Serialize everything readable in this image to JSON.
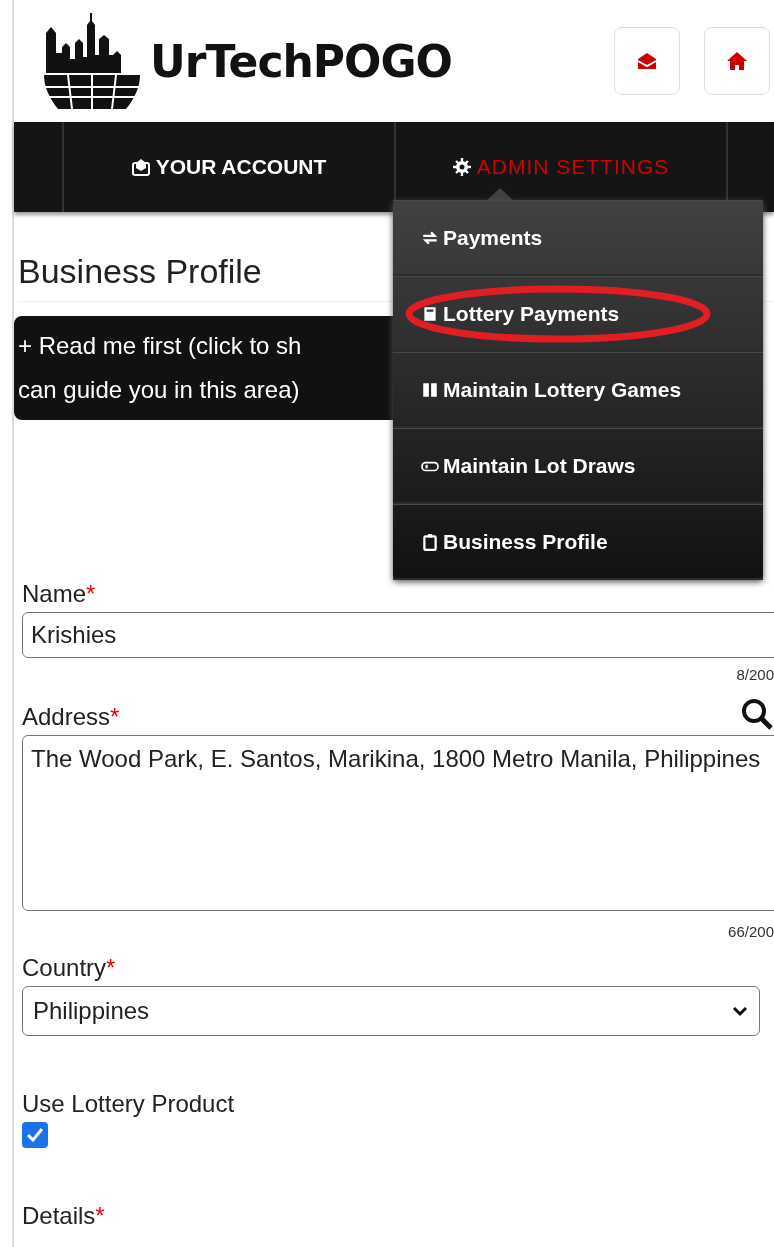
{
  "header": {
    "logo_text": "UrTechPOGO"
  },
  "nav": [
    {
      "label": "YOUR ACCOUNT",
      "selected": false
    },
    {
      "label": "ADMIN SETTINGS",
      "selected": true
    }
  ],
  "menu": [
    {
      "label": "Payments",
      "highlighted": false
    },
    {
      "label": "Lottery Payments",
      "highlighted": true
    },
    {
      "label": "Maintain Lottery Games",
      "highlighted": false
    },
    {
      "label": "Maintain Lot Draws",
      "highlighted": false
    },
    {
      "label": "Business Profile",
      "highlighted": false
    }
  ],
  "page_title": "Business Profile",
  "notice": {
    "lines": [
      "+ Read me first (click to sh",
      "can guide you in this area)"
    ]
  },
  "fields": [
    {
      "kind": "text",
      "label": "Name",
      "required_mark": "*",
      "value": "Krishies",
      "counter": "8/200"
    },
    {
      "kind": "textarea",
      "label": "Address",
      "required_mark": "*",
      "value": "The Wood Park, E. Santos, Marikina, 1800 Metro Manila, Philippines",
      "counter": "66/200",
      "search": true
    },
    {
      "kind": "select",
      "label": "Country",
      "required_mark": "*",
      "value": "Philippines"
    },
    {
      "kind": "checkbox",
      "label": "Use Lottery Product",
      "checked": true
    },
    {
      "kind": "heading",
      "label": "Details",
      "required_mark": "*"
    }
  ]
}
